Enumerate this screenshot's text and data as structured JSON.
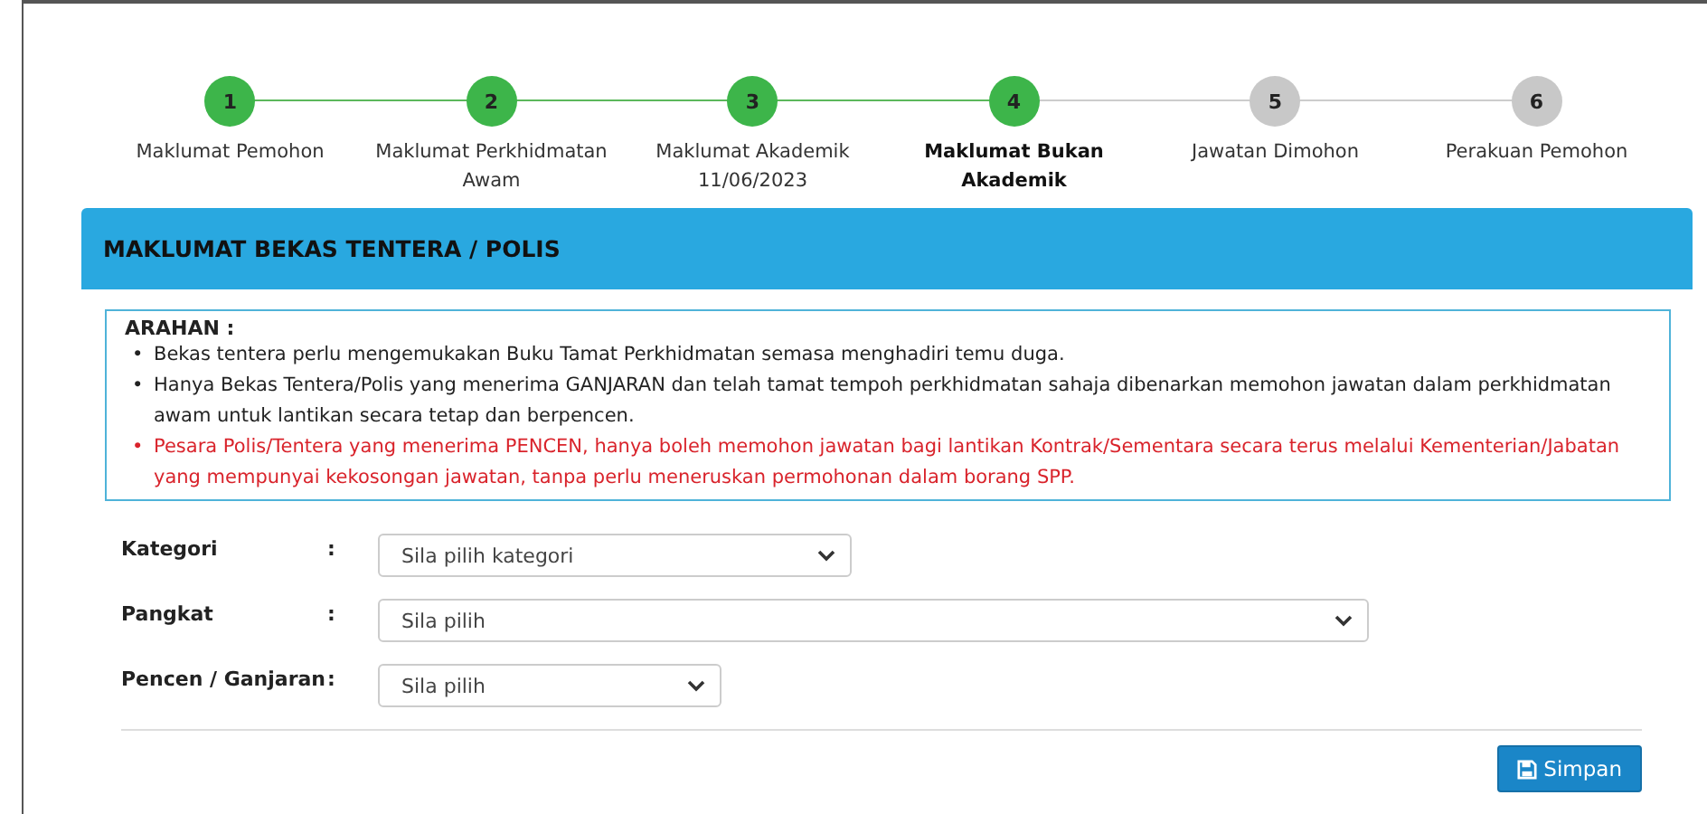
{
  "steps": [
    {
      "number": "1",
      "label": "Maklumat Pemohon",
      "kind": "done"
    },
    {
      "number": "2",
      "label": "Maklumat Perkhidmatan Awam",
      "kind": "done"
    },
    {
      "number": "3",
      "label": "Maklumat Akademik 11/06/2023",
      "kind": "done"
    },
    {
      "number": "4",
      "label": "Maklumat Bukan Akademik",
      "kind": "current"
    },
    {
      "number": "5",
      "label": "Jawatan Dimohon",
      "kind": "pending"
    },
    {
      "number": "6",
      "label": "Perakuan Pemohon",
      "kind": "pending"
    }
  ],
  "panel": {
    "title": "MAKLUMAT BEKAS TENTERA / POLIS",
    "notice": {
      "heading": "ARAHAN :",
      "marker": "•",
      "items": [
        {
          "text": "Bekas tentera perlu mengemukakan Buku Tamat Perkhidmatan semasa menghadiri temu duga.",
          "kind": "info"
        },
        {
          "text": "Hanya Bekas Tentera/Polis yang menerima GANJARAN dan telah tamat tempoh perkhidmatan sahaja dibenarkan memohon jawatan dalam perkhidmatan awam untuk lantikan secara tetap dan berpencen.",
          "kind": "info"
        },
        {
          "text": "Pesara Polis/Tentera yang menerima PENCEN, hanya boleh memohon jawatan bagi lantikan Kontrak/Sementara secara terus melalui Kementerian/Jabatan yang mempunyai kekosongan jawatan, tanpa perlu meneruskan permohonan dalam borang SPP.",
          "kind": "warning"
        }
      ]
    },
    "fields": [
      {
        "label": "Kategori",
        "separator": ":",
        "placeholder": "Sila pilih kategori",
        "kind": "medium"
      },
      {
        "label": "Pangkat",
        "separator": ":",
        "placeholder": "Sila pilih",
        "kind": "large"
      },
      {
        "label": "Pencen / Ganjaran",
        "separator": ":",
        "placeholder": "Sila pilih",
        "kind": "small"
      }
    ],
    "save_button": "Simpan"
  }
}
